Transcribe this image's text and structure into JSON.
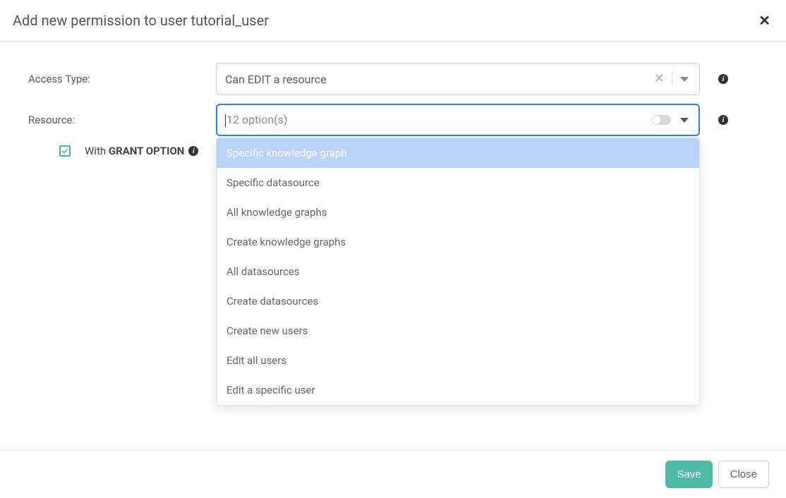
{
  "header": {
    "title": "Add new permission to user tutorial_user"
  },
  "form": {
    "access_type": {
      "label": "Access Type:",
      "value": "Can EDIT a resource"
    },
    "resource": {
      "label": "Resource:",
      "placeholder": "12 option(s)",
      "options": [
        "Specific knowledge graph",
        "Specific datasource",
        "All knowledge graphs",
        "Create knowledge graphs",
        "All datasources",
        "Create datasources",
        "Create new users",
        "Edit all users",
        "Edit a specific user"
      ]
    },
    "grant": {
      "prefix": "With ",
      "bold": "GRANT OPTION",
      "checked": true
    }
  },
  "footer": {
    "save": "Save",
    "close": "Close"
  },
  "info_glyph": "i",
  "close_glyph": "✕"
}
